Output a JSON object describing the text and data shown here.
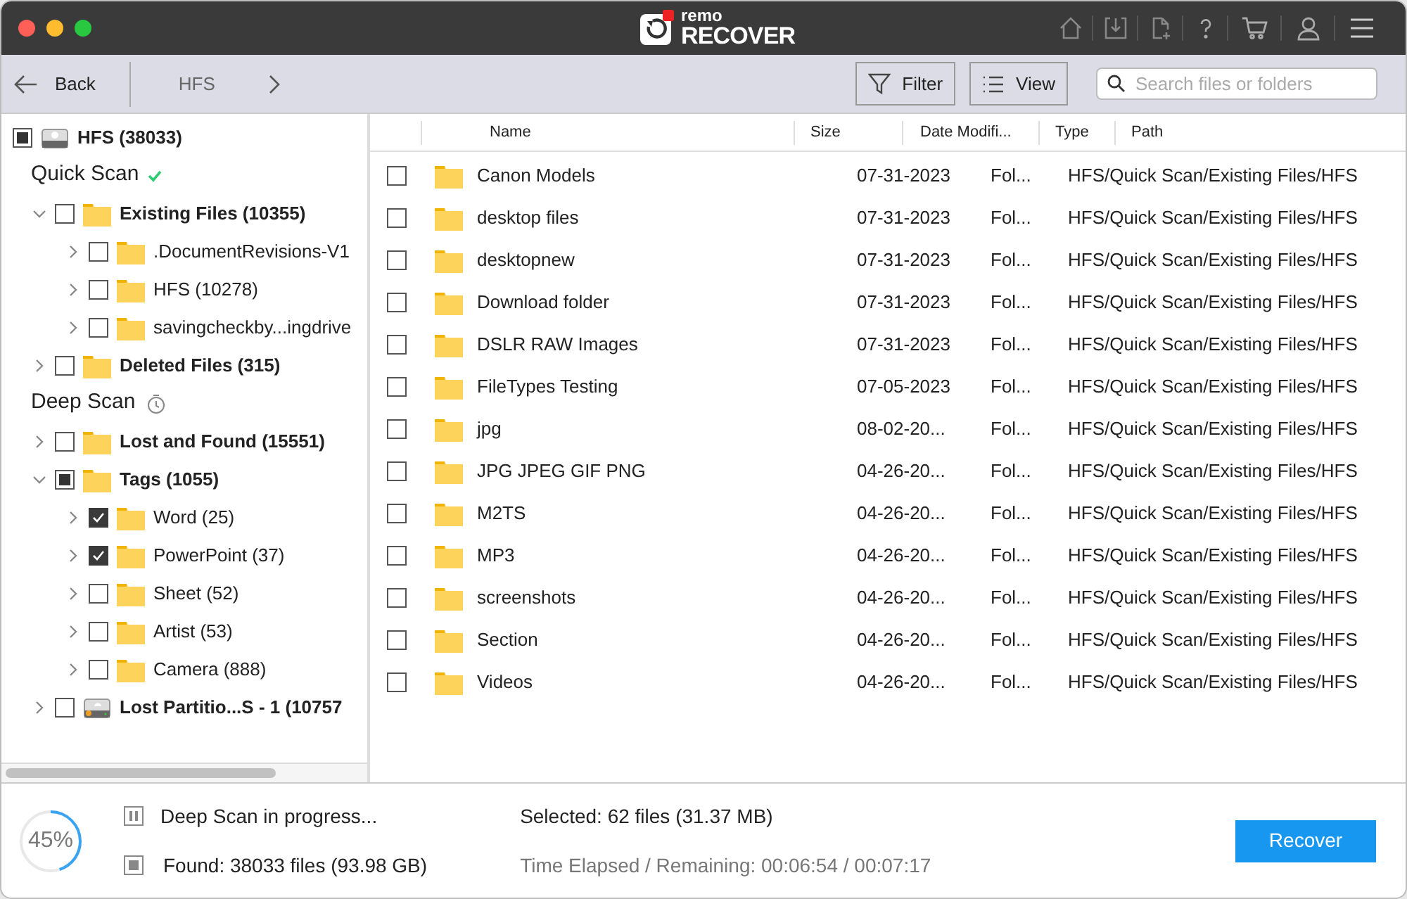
{
  "window": {
    "logo_top": "remo",
    "logo_bottom": "RECOVER"
  },
  "nav": {
    "back": "Back",
    "crumb": "HFS",
    "filter": "Filter",
    "view": "View",
    "search": {
      "placeholder": "Search files or folders"
    }
  },
  "tree": [
    {
      "kind": "drive",
      "label": "HFS (38033)",
      "checked": false,
      "partial": true,
      "children": [
        {
          "kind": "section",
          "label": "Quick Scan",
          "complete": true,
          "children": [
            {
              "kind": "folder",
              "label": "Existing Files (10355)",
              "checked": false,
              "partial": false,
              "expanded": true,
              "children": [
                {
                  "kind": "folder",
                  "label": ".DocumentRevisions-V1",
                  "checked": false,
                  "partial": false,
                  "expanded": false
                },
                {
                  "kind": "folder",
                  "label": "HFS (10278)",
                  "checked": false,
                  "partial": false,
                  "expanded": false
                },
                {
                  "kind": "folder",
                  "label": "savingcheckby...ingdrive",
                  "checked": false,
                  "partial": false,
                  "expanded": false
                }
              ]
            },
            {
              "kind": "folder",
              "label": "Deleted Files (315)",
              "checked": false,
              "partial": false,
              "expanded": false
            }
          ]
        },
        {
          "kind": "section",
          "label": "Deep Scan",
          "complete": false,
          "children": [
            {
              "kind": "folder",
              "label": "Lost and Found (15551)",
              "checked": false,
              "partial": false,
              "expanded": false
            },
            {
              "kind": "folder",
              "label": "Tags (1055)",
              "checked": false,
              "partial": true,
              "expanded": true,
              "children": [
                {
                  "kind": "folder",
                  "label": "Word (25)",
                  "checked": true,
                  "partial": false,
                  "expanded": false
                },
                {
                  "kind": "folder",
                  "label": "PowerPoint (37)",
                  "checked": true,
                  "partial": false,
                  "expanded": false
                },
                {
                  "kind": "folder",
                  "label": "Sheet (52)",
                  "checked": false,
                  "partial": false,
                  "expanded": false
                },
                {
                  "kind": "folder",
                  "label": "Artist (53)",
                  "checked": false,
                  "partial": false,
                  "expanded": false
                },
                {
                  "kind": "folder",
                  "label": "Camera (888)",
                  "checked": false,
                  "partial": false,
                  "expanded": false
                }
              ]
            },
            {
              "kind": "partition",
              "label": "Lost Partitio...S - 1 (10757",
              "checked": false,
              "partial": false,
              "expanded": false
            }
          ]
        }
      ]
    }
  ],
  "table": {
    "columns": [
      "Name",
      "Size",
      "Date Modifi...",
      "Type",
      "Path"
    ],
    "rows": [
      {
        "name": "Canon Models",
        "date": "07-31-2023",
        "type": "Fol...",
        "path": "HFS/Quick Scan/Existing Files/HFS",
        "checked": false
      },
      {
        "name": "desktop files",
        "date": "07-31-2023",
        "type": "Fol...",
        "path": "HFS/Quick Scan/Existing Files/HFS",
        "checked": false
      },
      {
        "name": "desktopnew",
        "date": "07-31-2023",
        "type": "Fol...",
        "path": "HFS/Quick Scan/Existing Files/HFS",
        "checked": false
      },
      {
        "name": "Download folder",
        "date": "07-31-2023",
        "type": "Fol...",
        "path": "HFS/Quick Scan/Existing Files/HFS",
        "checked": false
      },
      {
        "name": "DSLR RAW Images",
        "date": "07-31-2023",
        "type": "Fol...",
        "path": "HFS/Quick Scan/Existing Files/HFS",
        "checked": false
      },
      {
        "name": "FileTypes Testing",
        "date": "07-05-2023",
        "type": "Fol...",
        "path": "HFS/Quick Scan/Existing Files/HFS",
        "checked": false
      },
      {
        "name": "jpg",
        "date": "08-02-20...",
        "type": "Fol...",
        "path": "HFS/Quick Scan/Existing Files/HFS",
        "checked": false
      },
      {
        "name": "JPG JPEG GIF PNG",
        "date": "04-26-20...",
        "type": "Fol...",
        "path": "HFS/Quick Scan/Existing Files/HFS",
        "checked": false
      },
      {
        "name": "M2TS",
        "date": "04-26-20...",
        "type": "Fol...",
        "path": "HFS/Quick Scan/Existing Files/HFS",
        "checked": false
      },
      {
        "name": "MP3",
        "date": "04-26-20...",
        "type": "Fol...",
        "path": "HFS/Quick Scan/Existing Files/HFS",
        "checked": false
      },
      {
        "name": "screenshots",
        "date": "04-26-20...",
        "type": "Fol...",
        "path": "HFS/Quick Scan/Existing Files/HFS",
        "checked": false
      },
      {
        "name": "Section",
        "date": "04-26-20...",
        "type": "Fol...",
        "path": "HFS/Quick Scan/Existing Files/HFS",
        "checked": false
      },
      {
        "name": "Videos",
        "date": "04-26-20...",
        "type": "Fol...",
        "path": "HFS/Quick Scan/Existing Files/HFS",
        "checked": false
      }
    ]
  },
  "status_bar": {
    "progress": {
      "level": 0.45,
      "text": "45%"
    },
    "scan_status": "Deep Scan in progress...",
    "found": "Found: 38033 files (93.98 GB)",
    "selected": "Selected: 62 files (31.37 MB)",
    "time": "Time Elapsed / Remaining: 00:06:54 / 00:07:17",
    "recover": "Recover"
  }
}
